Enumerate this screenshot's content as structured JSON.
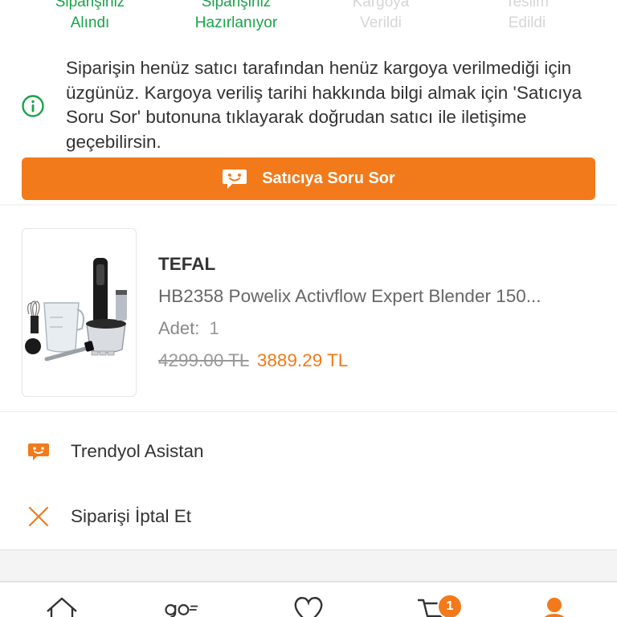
{
  "steps": [
    {
      "line1": "Siparişiniz",
      "line2": "Alındı",
      "state": "done"
    },
    {
      "line1": "Siparişiniz",
      "line2": "Hazırlanıyor",
      "state": "done"
    },
    {
      "line1": "Kargoya",
      "line2": "Verildi",
      "state": "pending"
    },
    {
      "line1": "Teslim",
      "line2": "Edildi",
      "state": "pending"
    }
  ],
  "info": {
    "icon": "info-circle-icon",
    "text": "Siparişin henüz satıcı tarafından henüz kargoya verilmediği için üzgünüz. Kargoya veriliş tarihi hakkında bilgi almak için 'Satıcıya Soru Sor' butonuna tıklayarak doğrudan satıcı ile iletişime geçebilirsin."
  },
  "ask_button": {
    "label": "Satıcıya Soru Sor",
    "icon": "chat-bubble-icon"
  },
  "product": {
    "brand": "TEFAL",
    "name": "HB2358 Powelix Activflow Expert Blender 150...",
    "qty_label": "Adet:",
    "qty_value": "1",
    "old_price": "4299.00 TL",
    "new_price": "3889.29 TL"
  },
  "actions": [
    {
      "label": "Trendyol Asistan",
      "icon": "assistant-chat-icon"
    },
    {
      "label": "Siparişi İptal Et",
      "icon": "close-x-icon"
    }
  ],
  "cart_badge": "1",
  "colors": {
    "brand_orange": "#f27a1a",
    "success_green": "#19a34a",
    "pending_gray": "#d6d6d6"
  }
}
